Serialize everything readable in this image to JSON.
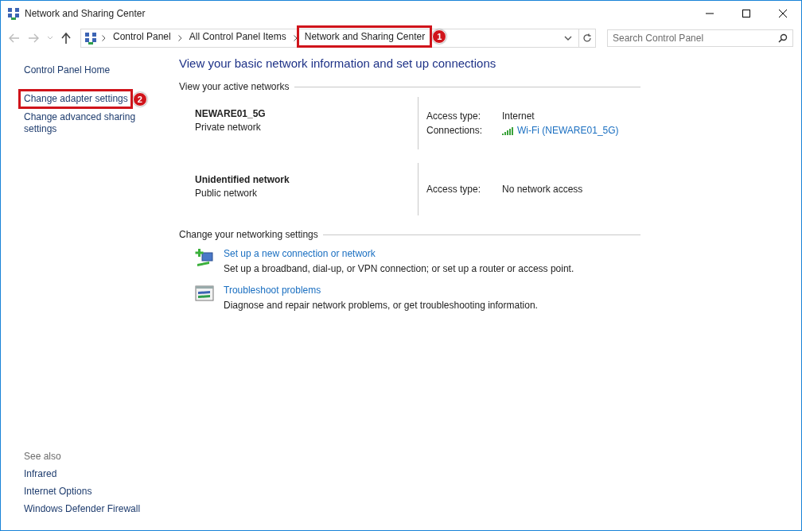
{
  "window": {
    "title": "Network and Sharing Center"
  },
  "address_bar": {
    "crumbs": [
      {
        "label": "Control Panel"
      },
      {
        "label": "All Control Panel Items"
      },
      {
        "label": "Network and Sharing Center",
        "callout": "1"
      }
    ]
  },
  "search": {
    "placeholder": "Search Control Panel"
  },
  "sidebar": {
    "links": [
      {
        "label": "Control Panel Home"
      },
      {
        "label": "Change adapter settings",
        "callout": "2"
      },
      {
        "label": "Change advanced sharing settings"
      }
    ],
    "see_also": {
      "title": "See also",
      "links": [
        "Infrared",
        "Internet Options",
        "Windows Defender Firewall"
      ]
    }
  },
  "main": {
    "heading": "View your basic network information and set up connections",
    "active_networks": {
      "title": "View your active networks",
      "networks": [
        {
          "name": "NEWARE01_5G",
          "category": "Private network",
          "details": [
            {
              "label": "Access type:",
              "value": "Internet",
              "kind": "text"
            },
            {
              "label": "Connections:",
              "value": "Wi-Fi (NEWARE01_5G)",
              "kind": "wifi-link"
            }
          ]
        },
        {
          "name": "Unidentified network",
          "category": "Public network",
          "details": [
            {
              "label": "Access type:",
              "value": "No network access",
              "kind": "text"
            }
          ]
        }
      ]
    },
    "settings": {
      "title": "Change your networking settings",
      "tasks": [
        {
          "kind": "new-connection",
          "link": "Set up a new connection or network",
          "description": "Set up a broadband, dial-up, or VPN connection; or set up a router or access point."
        },
        {
          "kind": "troubleshoot",
          "link": "Troubleshoot problems",
          "description": "Diagnose and repair network problems, or get troubleshooting information."
        }
      ]
    }
  }
}
